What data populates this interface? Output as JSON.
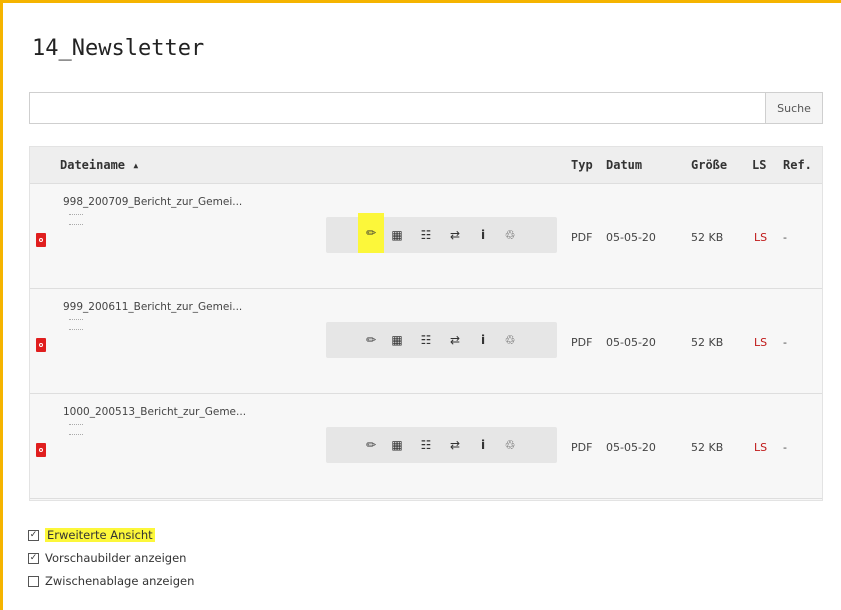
{
  "page": {
    "title": "14_Newsletter"
  },
  "search": {
    "placeholder": "",
    "value": "",
    "button_label": "Suche"
  },
  "table": {
    "headers": {
      "filename": "Dateiname ▴",
      "type": "Typ",
      "date": "Datum",
      "size": "Größe",
      "ls": "LS",
      "ref": "Ref."
    },
    "rows": [
      {
        "name": "998_200709_Bericht_zur_Gemei...",
        "type": "PDF",
        "date": "05-05-20",
        "size": "52 KB",
        "ls": "LS",
        "ref": "-"
      },
      {
        "name": "999_200611_Bericht_zur_Gemei...",
        "type": "PDF",
        "date": "05-05-20",
        "size": "52 KB",
        "ls": "LS",
        "ref": "-"
      },
      {
        "name": "1000_200513_Bericht_zur_Geme...",
        "type": "PDF",
        "date": "05-05-20",
        "size": "52 KB",
        "ls": "LS",
        "ref": "-"
      }
    ],
    "action_icons": [
      "edit-pencil-icon",
      "metadata-icon",
      "replace-icon",
      "rename-icon",
      "info-icon",
      "delete-trash-icon"
    ],
    "action_glyphs": {
      "edit": "✏",
      "metadata": "▦",
      "replace": "☷",
      "rename": "⇄",
      "info": "i",
      "delete": "♲"
    }
  },
  "options": {
    "extended_view": {
      "label": "Erweiterte Ansicht",
      "checked": true
    },
    "show_thumbnails": {
      "label": "Vorschaubilder anzeigen",
      "checked": true
    },
    "show_clipboard": {
      "label": "Zwischenablage anzeigen",
      "checked": false
    }
  },
  "colors": {
    "frame": "#f5b400",
    "highlight": "#fcf73a",
    "pdf_icon": "#e01e1e",
    "ls_link": "#c01818"
  }
}
